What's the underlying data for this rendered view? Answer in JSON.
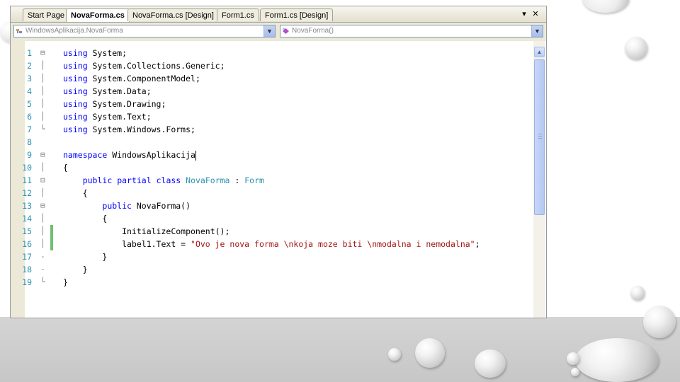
{
  "tabs": [
    {
      "label": "Start Page",
      "active": false
    },
    {
      "label": "NovaForma.cs",
      "active": true
    },
    {
      "label": "NovaForma.cs [Design]",
      "active": false
    },
    {
      "label": "Form1.cs",
      "active": false
    },
    {
      "label": "Form1.cs [Design]",
      "active": false
    }
  ],
  "tab_controls": {
    "dropdown": "▾",
    "close": "✕"
  },
  "nav": {
    "class_combo": "WindowsAplikacija.NovaForma",
    "member_combo": "NovaForma()"
  },
  "code_lines": [
    {
      "n": "1",
      "fold": "⊟",
      "tokens": [
        {
          "t": "using",
          "c": "kw"
        },
        {
          "t": " System;",
          "c": ""
        }
      ]
    },
    {
      "n": "2",
      "fold": "│",
      "tokens": [
        {
          "t": "using",
          "c": "kw"
        },
        {
          "t": " System.Collections.Generic;",
          "c": ""
        }
      ]
    },
    {
      "n": "3",
      "fold": "│",
      "tokens": [
        {
          "t": "using",
          "c": "kw"
        },
        {
          "t": " System.ComponentModel;",
          "c": ""
        }
      ]
    },
    {
      "n": "4",
      "fold": "│",
      "tokens": [
        {
          "t": "using",
          "c": "kw"
        },
        {
          "t": " System.Data;",
          "c": ""
        }
      ]
    },
    {
      "n": "5",
      "fold": "│",
      "tokens": [
        {
          "t": "using",
          "c": "kw"
        },
        {
          "t": " System.Drawing;",
          "c": ""
        }
      ]
    },
    {
      "n": "6",
      "fold": "│",
      "tokens": [
        {
          "t": "using",
          "c": "kw"
        },
        {
          "t": " System.Text;",
          "c": ""
        }
      ]
    },
    {
      "n": "7",
      "fold": "└",
      "tokens": [
        {
          "t": "using",
          "c": "kw"
        },
        {
          "t": " System.Windows.Forms;",
          "c": ""
        }
      ]
    },
    {
      "n": "8",
      "fold": "",
      "tokens": []
    },
    {
      "n": "9",
      "fold": "⊟",
      "tokens": [
        {
          "t": "namespace",
          "c": "kw"
        },
        {
          "t": " WindowsAplikacija",
          "c": ""
        }
      ],
      "caret": true
    },
    {
      "n": "10",
      "fold": "│",
      "tokens": [
        {
          "t": "{",
          "c": ""
        }
      ]
    },
    {
      "n": "11",
      "fold": "⊟",
      "tokens": [
        {
          "t": "    ",
          "c": ""
        },
        {
          "t": "public",
          "c": "kw"
        },
        {
          "t": " ",
          "c": ""
        },
        {
          "t": "partial",
          "c": "kw"
        },
        {
          "t": " ",
          "c": ""
        },
        {
          "t": "class",
          "c": "kw"
        },
        {
          "t": " ",
          "c": ""
        },
        {
          "t": "NovaForma",
          "c": "ty"
        },
        {
          "t": " : ",
          "c": ""
        },
        {
          "t": "Form",
          "c": "ty"
        }
      ]
    },
    {
      "n": "12",
      "fold": "│",
      "tokens": [
        {
          "t": "    {",
          "c": ""
        }
      ]
    },
    {
      "n": "13",
      "fold": "⊟",
      "tokens": [
        {
          "t": "        ",
          "c": ""
        },
        {
          "t": "public",
          "c": "kw"
        },
        {
          "t": " NovaForma()",
          "c": ""
        }
      ]
    },
    {
      "n": "14",
      "fold": "│",
      "tokens": [
        {
          "t": "        {",
          "c": ""
        }
      ]
    },
    {
      "n": "15",
      "fold": "│",
      "changed": true,
      "tokens": [
        {
          "t": "            InitializeComponent();",
          "c": ""
        }
      ]
    },
    {
      "n": "16",
      "fold": "│",
      "changed": true,
      "tokens": [
        {
          "t": "            label1.Text = ",
          "c": ""
        },
        {
          "t": "\"Ovo je nova forma \\nkoja moze biti \\nmodalna i nemodalna\"",
          "c": "str"
        },
        {
          "t": ";",
          "c": ""
        }
      ]
    },
    {
      "n": "17",
      "fold": "-",
      "tokens": [
        {
          "t": "        }",
          "c": ""
        }
      ]
    },
    {
      "n": "18",
      "fold": "-",
      "tokens": [
        {
          "t": "    }",
          "c": ""
        }
      ]
    },
    {
      "n": "19",
      "fold": "└",
      "tokens": [
        {
          "t": "}",
          "c": ""
        }
      ]
    }
  ],
  "scrollbar": {
    "up": "▲",
    "grip": "≡"
  },
  "colors": {
    "keyword": "#0000ff",
    "type": "#2b91af",
    "string": "#a31515",
    "line_number": "#2b91af"
  }
}
